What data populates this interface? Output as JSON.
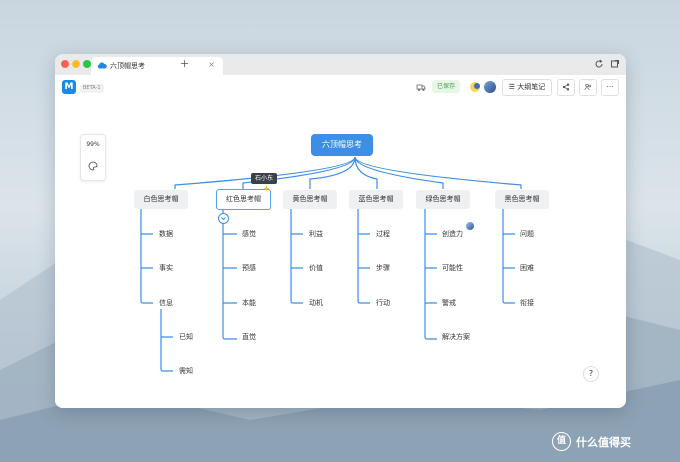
{
  "tab": {
    "title": "六顶帽思考",
    "close": "×",
    "new": "+"
  },
  "toolbar": {
    "beta": "BETA-1",
    "saved": "已保存",
    "outline": "大纲笔记",
    "more": "···"
  },
  "zoom": {
    "value": "99%"
  },
  "tooltip": {
    "text": "石小东"
  },
  "mindmap": {
    "root": "六顶帽思考",
    "branches": [
      {
        "label": "白色思考帽",
        "children": [
          "数据",
          "事实",
          "信息"
        ],
        "sub": [
          "已知",
          "需知"
        ]
      },
      {
        "label": "红色思考帽",
        "children": [
          "感觉",
          "预感",
          "本能",
          "直觉"
        ]
      },
      {
        "label": "黄色思考帽",
        "children": [
          "利益",
          "价值",
          "动机"
        ]
      },
      {
        "label": "蓝色思考帽",
        "children": [
          "过程",
          "步骤",
          "行动"
        ]
      },
      {
        "label": "绿色思考帽",
        "children": [
          "创造力",
          "可能性",
          "警戒",
          "解决方案"
        ]
      },
      {
        "label": "黑色思考帽",
        "children": [
          "问题",
          "困难",
          "衔接"
        ]
      }
    ]
  },
  "help": {
    "label": "?"
  },
  "watermark": {
    "text": "什么值得买",
    "logo": "值"
  },
  "colors": {
    "accent": "#3d8ee6",
    "saved": "#43a047"
  }
}
